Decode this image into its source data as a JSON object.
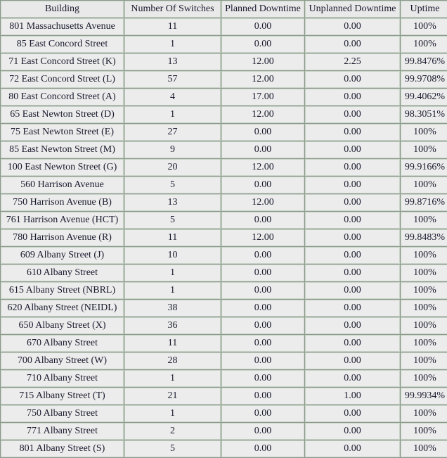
{
  "table": {
    "columns": [
      {
        "key": "building",
        "label": "Building"
      },
      {
        "key": "switches",
        "label": "Number Of Switches"
      },
      {
        "key": "planned",
        "label": "Planned Downtime"
      },
      {
        "key": "unplanned",
        "label": "Unplanned Downtime"
      },
      {
        "key": "uptime",
        "label": "Uptime"
      }
    ],
    "colors": {
      "highlight_green": "#8fd14f",
      "highlight_pink": "#eeb0ab",
      "cell_background": "#ececec",
      "border": "#8a9a8a",
      "text": "#1a1a2e"
    },
    "rows": [
      {
        "building": "801 Massachusetts Avenue",
        "switches": "11",
        "planned": "0.00",
        "unplanned": "0.00",
        "uptime": "100%",
        "planned_hl": "none",
        "unplanned_hl": "none",
        "uptime_hl": "none"
      },
      {
        "building": "85 East Concord Street",
        "switches": "1",
        "planned": "0.00",
        "unplanned": "0.00",
        "uptime": "100%",
        "planned_hl": "none",
        "unplanned_hl": "none",
        "uptime_hl": "none"
      },
      {
        "building": "71 East Concord Street (K)",
        "switches": "13",
        "planned": "12.00",
        "unplanned": "2.25",
        "uptime": "99.8476%",
        "planned_hl": "green",
        "unplanned_hl": "pink",
        "uptime_hl": "pink"
      },
      {
        "building": "72 East Concord Street (L)",
        "switches": "57",
        "planned": "12.00",
        "unplanned": "0.00",
        "uptime": "99.9708%",
        "planned_hl": "green",
        "unplanned_hl": "none",
        "uptime_hl": "green"
      },
      {
        "building": "80 East Concord Street (A)",
        "switches": "4",
        "planned": "17.00",
        "unplanned": "0.00",
        "uptime": "99.4062%",
        "planned_hl": "green",
        "unplanned_hl": "none",
        "uptime_hl": "green"
      },
      {
        "building": "65 East Newton Street (D)",
        "switches": "1",
        "planned": "12.00",
        "unplanned": "0.00",
        "uptime": "98.3051%",
        "planned_hl": "green",
        "unplanned_hl": "none",
        "uptime_hl": "green"
      },
      {
        "building": "75 East Newton Street (E)",
        "switches": "27",
        "planned": "0.00",
        "unplanned": "0.00",
        "uptime": "100%",
        "planned_hl": "none",
        "unplanned_hl": "none",
        "uptime_hl": "none"
      },
      {
        "building": "85 East Newton Street (M)",
        "switches": "9",
        "planned": "0.00",
        "unplanned": "0.00",
        "uptime": "100%",
        "planned_hl": "none",
        "unplanned_hl": "none",
        "uptime_hl": "none"
      },
      {
        "building": "100 East Newton Street (G)",
        "switches": "20",
        "planned": "12.00",
        "unplanned": "0.00",
        "uptime": "99.9166%",
        "planned_hl": "green",
        "unplanned_hl": "none",
        "uptime_hl": "green"
      },
      {
        "building": "560 Harrison Avenue",
        "switches": "5",
        "planned": "0.00",
        "unplanned": "0.00",
        "uptime": "100%",
        "planned_hl": "none",
        "unplanned_hl": "none",
        "uptime_hl": "none"
      },
      {
        "building": "750 Harrison Avenue (B)",
        "switches": "13",
        "planned": "12.00",
        "unplanned": "0.00",
        "uptime": "99.8716%",
        "planned_hl": "green",
        "unplanned_hl": "none",
        "uptime_hl": "green"
      },
      {
        "building": "761 Harrison Avenue (HCT)",
        "switches": "5",
        "planned": "0.00",
        "unplanned": "0.00",
        "uptime": "100%",
        "planned_hl": "none",
        "unplanned_hl": "none",
        "uptime_hl": "none"
      },
      {
        "building": "780 Harrison Avenue (R)",
        "switches": "11",
        "planned": "12.00",
        "unplanned": "0.00",
        "uptime": "99.8483%",
        "planned_hl": "green",
        "unplanned_hl": "none",
        "uptime_hl": "green"
      },
      {
        "building": "609 Albany Street (J)",
        "switches": "10",
        "planned": "0.00",
        "unplanned": "0.00",
        "uptime": "100%",
        "planned_hl": "none",
        "unplanned_hl": "none",
        "uptime_hl": "none"
      },
      {
        "building": "610 Albany Street",
        "switches": "1",
        "planned": "0.00",
        "unplanned": "0.00",
        "uptime": "100%",
        "planned_hl": "none",
        "unplanned_hl": "none",
        "uptime_hl": "none"
      },
      {
        "building": "615 Albany Street (NBRL)",
        "switches": "1",
        "planned": "0.00",
        "unplanned": "0.00",
        "uptime": "100%",
        "planned_hl": "none",
        "unplanned_hl": "none",
        "uptime_hl": "none"
      },
      {
        "building": "620 Albany Street (NEIDL)",
        "switches": "38",
        "planned": "0.00",
        "unplanned": "0.00",
        "uptime": "100%",
        "planned_hl": "none",
        "unplanned_hl": "none",
        "uptime_hl": "none"
      },
      {
        "building": "650 Albany Street (X)",
        "switches": "36",
        "planned": "0.00",
        "unplanned": "0.00",
        "uptime": "100%",
        "planned_hl": "none",
        "unplanned_hl": "none",
        "uptime_hl": "none"
      },
      {
        "building": "670 Albany Street",
        "switches": "11",
        "planned": "0.00",
        "unplanned": "0.00",
        "uptime": "100%",
        "planned_hl": "none",
        "unplanned_hl": "none",
        "uptime_hl": "none"
      },
      {
        "building": "700 Albany Street (W)",
        "switches": "28",
        "planned": "0.00",
        "unplanned": "0.00",
        "uptime": "100%",
        "planned_hl": "none",
        "unplanned_hl": "none",
        "uptime_hl": "none"
      },
      {
        "building": "710 Albany Street",
        "switches": "1",
        "planned": "0.00",
        "unplanned": "0.00",
        "uptime": "100%",
        "planned_hl": "none",
        "unplanned_hl": "none",
        "uptime_hl": "none"
      },
      {
        "building": "715 Albany Street (T)",
        "switches": "21",
        "planned": "0.00",
        "unplanned": "1.00",
        "uptime": "99.9934%",
        "planned_hl": "none",
        "unplanned_hl": "pink",
        "uptime_hl": "pink"
      },
      {
        "building": "750 Albany Street",
        "switches": "1",
        "planned": "0.00",
        "unplanned": "0.00",
        "uptime": "100%",
        "planned_hl": "none",
        "unplanned_hl": "none",
        "uptime_hl": "none"
      },
      {
        "building": "771 Albany Street",
        "switches": "2",
        "planned": "0.00",
        "unplanned": "0.00",
        "uptime": "100%",
        "planned_hl": "none",
        "unplanned_hl": "none",
        "uptime_hl": "none"
      },
      {
        "building": "801 Albany Street (S)",
        "switches": "5",
        "planned": "0.00",
        "unplanned": "0.00",
        "uptime": "100%",
        "planned_hl": "none",
        "unplanned_hl": "none",
        "uptime_hl": "none"
      }
    ]
  }
}
